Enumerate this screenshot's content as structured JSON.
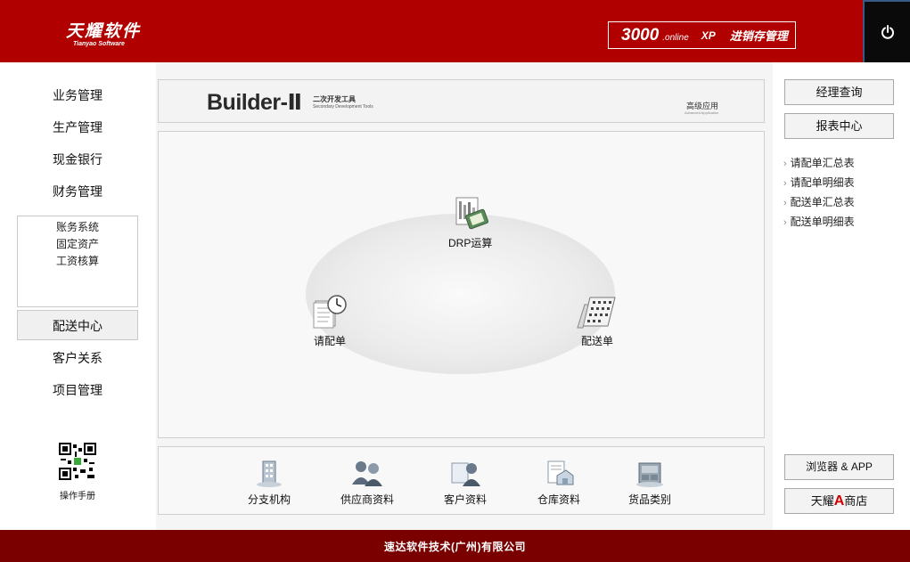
{
  "header": {
    "brand_cn": "天耀软件",
    "brand_en": "Tianyao Software",
    "product_number": "3000",
    "product_suffix": ".online",
    "product_edition": "XP",
    "product_name": "进销存管理",
    "power_icon": "power-icon"
  },
  "left_nav": {
    "items": [
      {
        "label": "业务管理"
      },
      {
        "label": "生产管理"
      },
      {
        "label": "现金银行"
      },
      {
        "label": "财务管理"
      }
    ],
    "sub_items": [
      {
        "label": "账务系统"
      },
      {
        "label": "固定资产"
      },
      {
        "label": "工资核算"
      }
    ],
    "items_after": [
      {
        "label": "配送中心",
        "active": true
      },
      {
        "label": "客户关系"
      },
      {
        "label": "项目管理"
      }
    ],
    "manual_label": "操作手册"
  },
  "banner": {
    "title": "Builder-Ⅱ",
    "subtitle_cn": "二次开发工具",
    "subtitle_en": "Secondary Development Tools",
    "advanced_cn": "高级应用",
    "advanced_en": "Advanced Application"
  },
  "workflow": {
    "nodes": [
      {
        "label": "DRP运算",
        "icon": "drp-calculation-icon"
      },
      {
        "label": "请配单",
        "icon": "request-order-icon"
      },
      {
        "label": "配送单",
        "icon": "delivery-order-icon"
      }
    ]
  },
  "bottom": {
    "items": [
      {
        "label": "分支机构",
        "icon": "branch-icon"
      },
      {
        "label": "供应商资料",
        "icon": "supplier-icon"
      },
      {
        "label": "客户资料",
        "icon": "customer-icon"
      },
      {
        "label": "仓库资料",
        "icon": "warehouse-icon"
      },
      {
        "label": "货品类别",
        "icon": "goods-category-icon"
      }
    ]
  },
  "right_panel": {
    "manager_query": "经理查询",
    "report_center": "报表中心",
    "links": [
      {
        "label": "请配单汇总表"
      },
      {
        "label": "请配单明细表"
      },
      {
        "label": "配送单汇总表"
      },
      {
        "label": "配送单明细表"
      }
    ],
    "browser_app": "浏览器 & APP",
    "store_prefix": "天耀",
    "store_letter": "A",
    "store_suffix": "商店"
  },
  "footer": {
    "text": "速达软件技术(广州)有限公司"
  },
  "colors": {
    "header_red": "#b00000",
    "footer_red": "#7a0000",
    "store_accent": "#d10000"
  }
}
